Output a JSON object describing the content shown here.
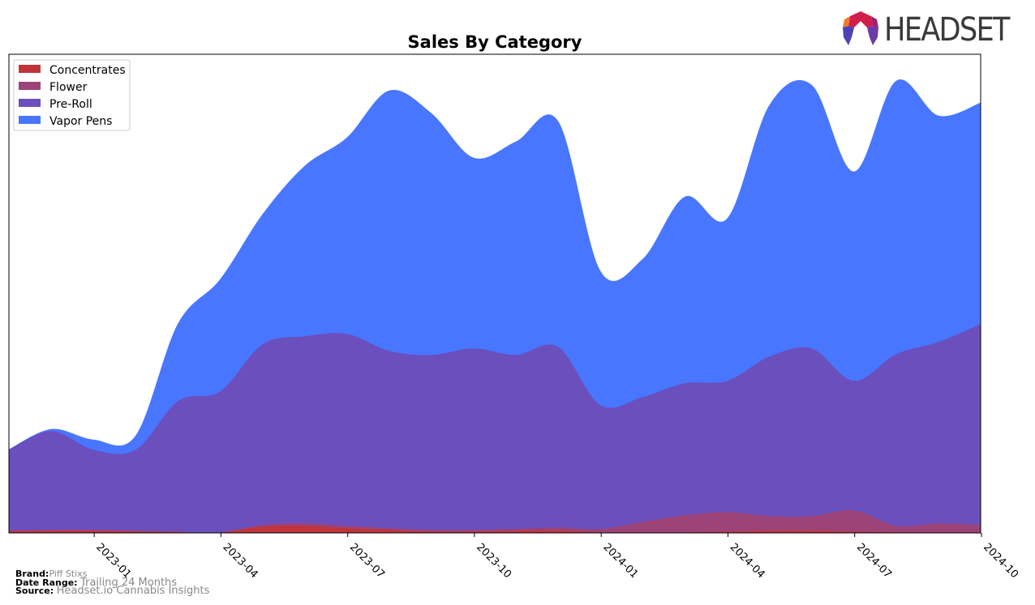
{
  "logo": {
    "text": "HEADSET"
  },
  "footer": {
    "brand_key": "Brand:",
    "brand_value": "Piff Stixs",
    "range_key": "Date Range:",
    "range_value": "Trailing 24 Months",
    "source_key": "Source:",
    "source_value": "Headset.io Cannabis Insights"
  },
  "chart_data": {
    "type": "area",
    "stacked": true,
    "smoothed": true,
    "title": "Sales By Category",
    "xlabel": "",
    "ylabel": "",
    "y_units": "relative sales (no y-axis shown)",
    "ylim": [
      0,
      591
    ],
    "grid": false,
    "legend_position": "top-left",
    "x": [
      "2022-11",
      "2022-12",
      "2023-01",
      "2023-02",
      "2023-03",
      "2023-04",
      "2023-05",
      "2023-06",
      "2023-07",
      "2023-08",
      "2023-09",
      "2023-10",
      "2023-11",
      "2023-12",
      "2024-01",
      "2024-02",
      "2024-03",
      "2024-04",
      "2024-05",
      "2024-06",
      "2024-07",
      "2024-08",
      "2024-09",
      "2024-10"
    ],
    "xticks": [
      "2023-01",
      "2023-04",
      "2023-07",
      "2023-10",
      "2024-01",
      "2024-04",
      "2024-07",
      "2024-10"
    ],
    "series": [
      {
        "name": "Concentrates",
        "color": "#c0343a",
        "values": [
          3,
          3,
          3,
          2,
          1,
          1,
          8,
          9,
          6,
          4,
          2,
          2,
          3,
          3,
          1,
          1,
          1,
          2,
          3,
          3,
          2,
          1,
          1,
          1
        ]
      },
      {
        "name": "Flower",
        "color": "#9b4378",
        "values": [
          0,
          1,
          1,
          1,
          1,
          0,
          2,
          3,
          3,
          2,
          2,
          2,
          2,
          4,
          4,
          13,
          21,
          24,
          18,
          18,
          26,
          8,
          11,
          9
        ]
      },
      {
        "name": "Pre-Roll",
        "color": "#6a4fbd",
        "values": [
          100,
          122,
          99,
          100,
          161,
          174,
          223,
          231,
          237,
          219,
          216,
          224,
          215,
          223,
          153,
          154,
          163,
          162,
          197,
          207,
          160,
          212,
          224,
          248
        ]
      },
      {
        "name": "Vapor Pens",
        "color": "#4876ff",
        "values": [
          0,
          2,
          12,
          17,
          95,
          138,
          160,
          210,
          242,
          321,
          298,
          235,
          263,
          278,
          165,
          170,
          230,
          200,
          310,
          325,
          258,
          337,
          279,
          273
        ]
      }
    ]
  }
}
